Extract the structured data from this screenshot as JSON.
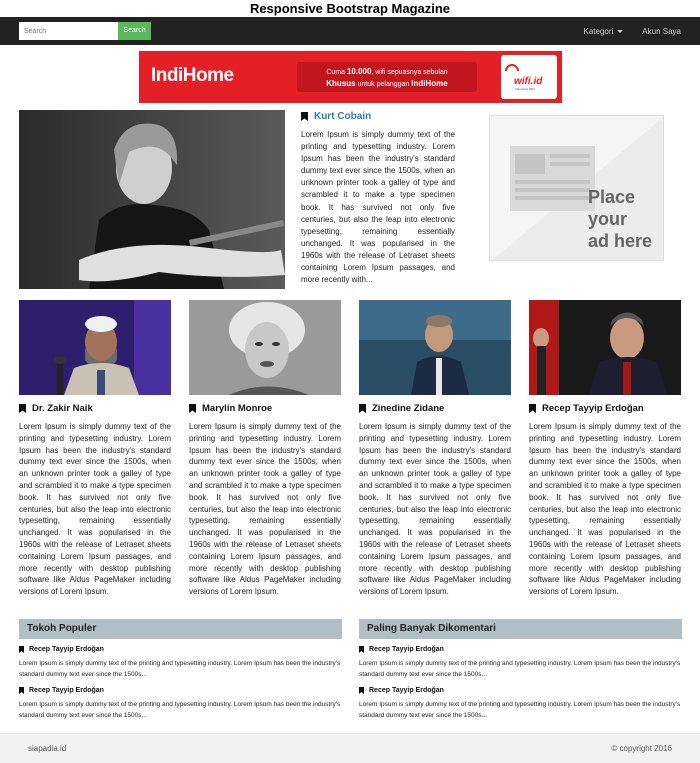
{
  "page_title": "Responsive Bootstrap Magazine",
  "navbar": {
    "search_placeholder": "Search",
    "search_button": "Search",
    "menu_kategori": "Kategori",
    "menu_akun": "Akun Saya"
  },
  "banner": {
    "brand": "IndiHome",
    "line1_prefix": "Cuma ",
    "line1_price": "10.000",
    "line1_suffix": ", wifi sepuasnya sebulan",
    "line2_bold1": "Khusus",
    "line2_mid": " untuk pelanggan ",
    "line2_bold2": "IndiHome",
    "wifi_brand": "wifi.id",
    "wifi_sub": "Indonesia WiFi"
  },
  "featured": {
    "name": "Kurt Cobain",
    "text": "Lorem Ipsum is simply dummy text of the printing and typesetting industry. Lorem Ipsum has been the industry's standard dummy text ever since the 1500s, when an unknown printer took a galley of type and scrambled it to make a type specimen book. It has survived not only five centuries, but also the leap into electronic typesetting, remaining essentially unchanged. It was popularised in the 1960s with the release of Letraset sheets containing Lorem Ipsum passages, and more recently with..."
  },
  "ad": {
    "line1": "Place",
    "line2": "your",
    "line3": "ad here"
  },
  "cards": [
    {
      "name": "Dr. Zakir Naik",
      "text": "Lorem Ipsum is simply dummy text of the printing and typesetting industry. Lorem Ipsum has been the industry's standard dummy text ever since the 1500s, when an unknown printer took a galley of type and scrambled it to make a type specimen book. It has survived not only five centuries, but also the leap into electronic typesetting, remaining essentially unchanged. It was popularised in the 1960s with the release of Letraset sheets containing Lorem Ipsum passages, and more recently with desktop publishing software like Aldus PageMaker including versions of Lorem Ipsum."
    },
    {
      "name": "Marylin Monroe",
      "text": "Lorem Ipsum is simply dummy text of the printing and typesetting industry. Lorem Ipsum has been the industry's standard dummy text ever since the 1500s, when an unknown printer took a galley of type and scrambled it to make a type specimen book. It has survived not only five centuries, but also the leap into electronic typesetting, remaining essentially unchanged. It was popularised in the 1960s with the release of Letraset sheets containing Lorem Ipsum passages, and more recently with desktop publishing software like Aldus PageMaker including versions of Lorem Ipsum."
    },
    {
      "name": "Zinedine Zidane",
      "text": "Lorem Ipsum is simply dummy text of the printing and typesetting industry. Lorem Ipsum has been the industry's standard dummy text ever since the 1500s, when an unknown printer took a galley of type and scrambled it to make a type specimen book. It has survived not only five centuries, but also the leap into electronic typesetting, remaining essentially unchanged. It was popularised in the 1960s with the release of Letraset sheets containing Lorem Ipsum passages, and more recently with desktop publishing software like Aldus PageMaker including versions of Lorem Ipsum."
    },
    {
      "name": "Recep Tayyip Erdoğan",
      "text": "Lorem Ipsum is simply dummy text of the printing and typesetting industry. Lorem Ipsum has been the industry's standard dummy text ever since the 1500s, when an unknown printer took a galley of type and scrambled it to make a type specimen book. It has survived not only five centuries, but also the leap into electronic typesetting, remaining essentially unchanged. It was popularised in the 1960s with the release of Letraset sheets containing Lorem Ipsum passages, and more recently with desktop publishing software like Aldus PageMaker including versions of Lorem Ipsum."
    }
  ],
  "sections": {
    "populer": {
      "title": "Tokoh Populer",
      "items": [
        {
          "name": "Recep Tayyip Erdoğan",
          "text": "Lorem Ipsum is simply dummy text of the printing and typesetting industry. Lorem Ipsum has been the industry's standard dummy text ever since the 1500s..."
        },
        {
          "name": "Recep Tayyip Erdoğan",
          "text": "Lorem Ipsum is simply dummy text of the printing and typesetting industry. Lorem Ipsum has been the industry's standard dummy text ever since the 1500s..."
        }
      ]
    },
    "komentar": {
      "title": "Paling Banyak Dikomentari",
      "items": [
        {
          "name": "Recep Tayyip Erdoğan",
          "text": "Lorem Ipsum is simply dummy text of the printing and typesetting industry. Lorem Ipsum has been the industry's standard dummy text ever since the 1500s..."
        },
        {
          "name": "Recep Tayyip Erdoğan",
          "text": "Lorem Ipsum is simply dummy text of the printing and typesetting industry. Lorem Ipsum has been the industry's standard dummy text ever since the 1500s..."
        }
      ]
    }
  },
  "footer": {
    "left": "siapadia.id",
    "right": "© copyright 2016"
  },
  "colors": {
    "navbar": "#222222",
    "search_button": "#5cb85c",
    "banner_red": "#e42027",
    "link_blue": "#337ab7",
    "section_header": "#b0bec5"
  }
}
